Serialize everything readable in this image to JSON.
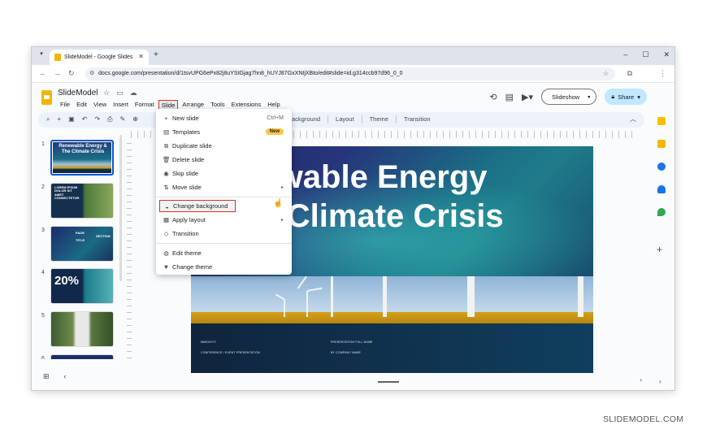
{
  "browser": {
    "tab_title": "SlideModel - Google Slides",
    "url": "docs.google.com/presentation/d/1tsvUPG6ePx82j8uYStGjag7hn8_hUYJ87GxXNtjXBto/edit#slide=id.g314ccb97d96_0_0"
  },
  "app": {
    "doc_title": "SlideModel",
    "menus": [
      "File",
      "Edit",
      "View",
      "Insert",
      "Format",
      "Slide",
      "Arrange",
      "Tools",
      "Extensions",
      "Help"
    ],
    "active_menu": "Slide",
    "slideshow_label": "Slideshow",
    "share_label": "Share"
  },
  "toolbar": {
    "background_label": "ackground",
    "layout_label": "Layout",
    "theme_label": "Theme",
    "transition_label": "Transition"
  },
  "slide_menu": {
    "new_slide": "New slide",
    "new_slide_shortcut": "Ctrl+M",
    "templates": "Templates",
    "templates_badge": "New",
    "duplicate_slide": "Duplicate slide",
    "delete_slide": "Delete slide",
    "skip_slide": "Skip slide",
    "move_slide": "Move slide",
    "change_background": "Change background",
    "apply_layout": "Apply layout",
    "transition": "Transition",
    "edit_theme": "Edit theme",
    "change_theme": "Change theme"
  },
  "filmstrip": {
    "numbers": [
      "1",
      "2",
      "3",
      "4",
      "5",
      "6"
    ],
    "thumb1_title": "Renewable Energy & The Climate Crisis",
    "thumb2_title": "LOREM IPSUM DOLOR SIT AMET CONSECTETUR",
    "thumb3_labels": [
      "PAGE",
      "TITLE",
      "SECTION"
    ],
    "thumb4_text": "20%"
  },
  "slide": {
    "title": "newable Energy\nhe Climate Crisis",
    "footer_left_1": "MM/DD/YY",
    "footer_left_2": "CONFERENCE / EVENT PRESENTATION",
    "footer_right_1": "PRESENTATION FULL NAME",
    "footer_right_2": "BY COMPANY NAME"
  },
  "watermark": "SLIDEMODEL.COM",
  "colors": {
    "accent_blue": "#0b57d0",
    "highlight_red": "#d93025",
    "slides_yellow": "#f4b400",
    "share_bg": "#c2e7ff"
  }
}
